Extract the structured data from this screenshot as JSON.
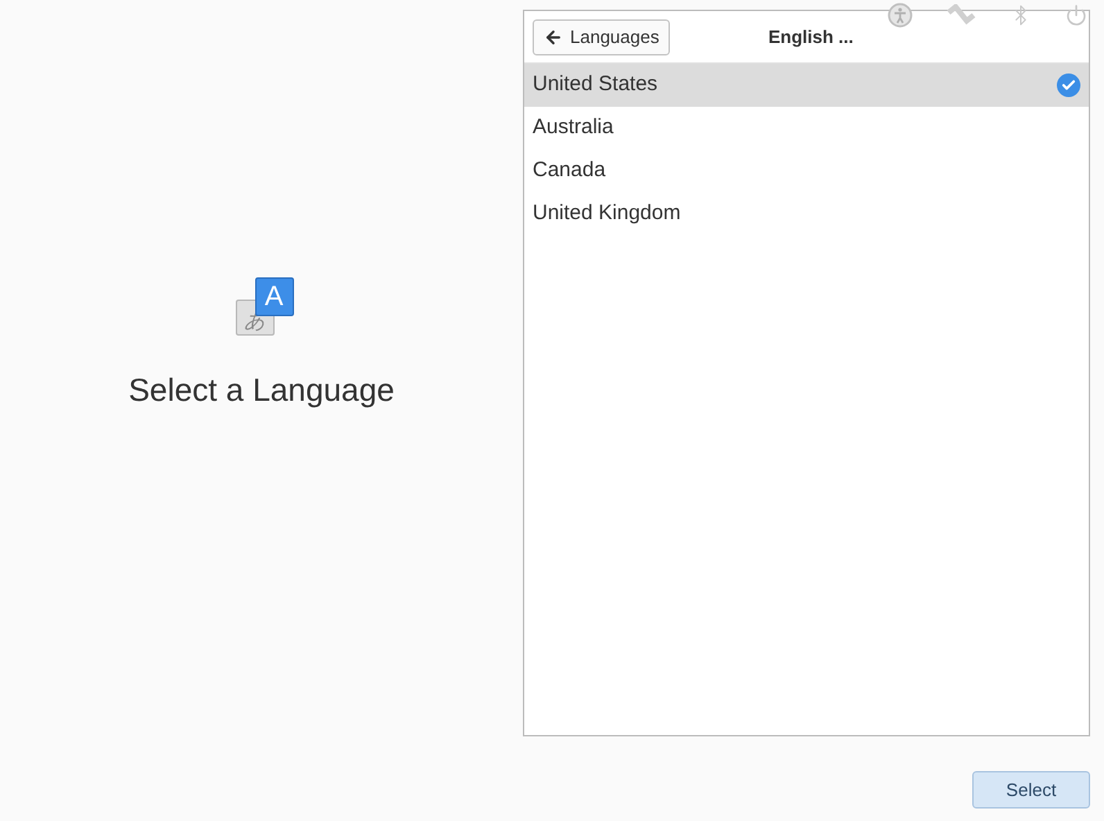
{
  "language_icon": {
    "front_glyph": "A",
    "back_glyph": "あ"
  },
  "title": "Select a Language",
  "panel": {
    "back_button": "Languages",
    "heading": "English ...",
    "items": [
      {
        "label": "United States",
        "selected": true
      },
      {
        "label": "Australia",
        "selected": false
      },
      {
        "label": "Canada",
        "selected": false
      },
      {
        "label": "United Kingdom",
        "selected": false
      }
    ]
  },
  "select_button": "Select"
}
